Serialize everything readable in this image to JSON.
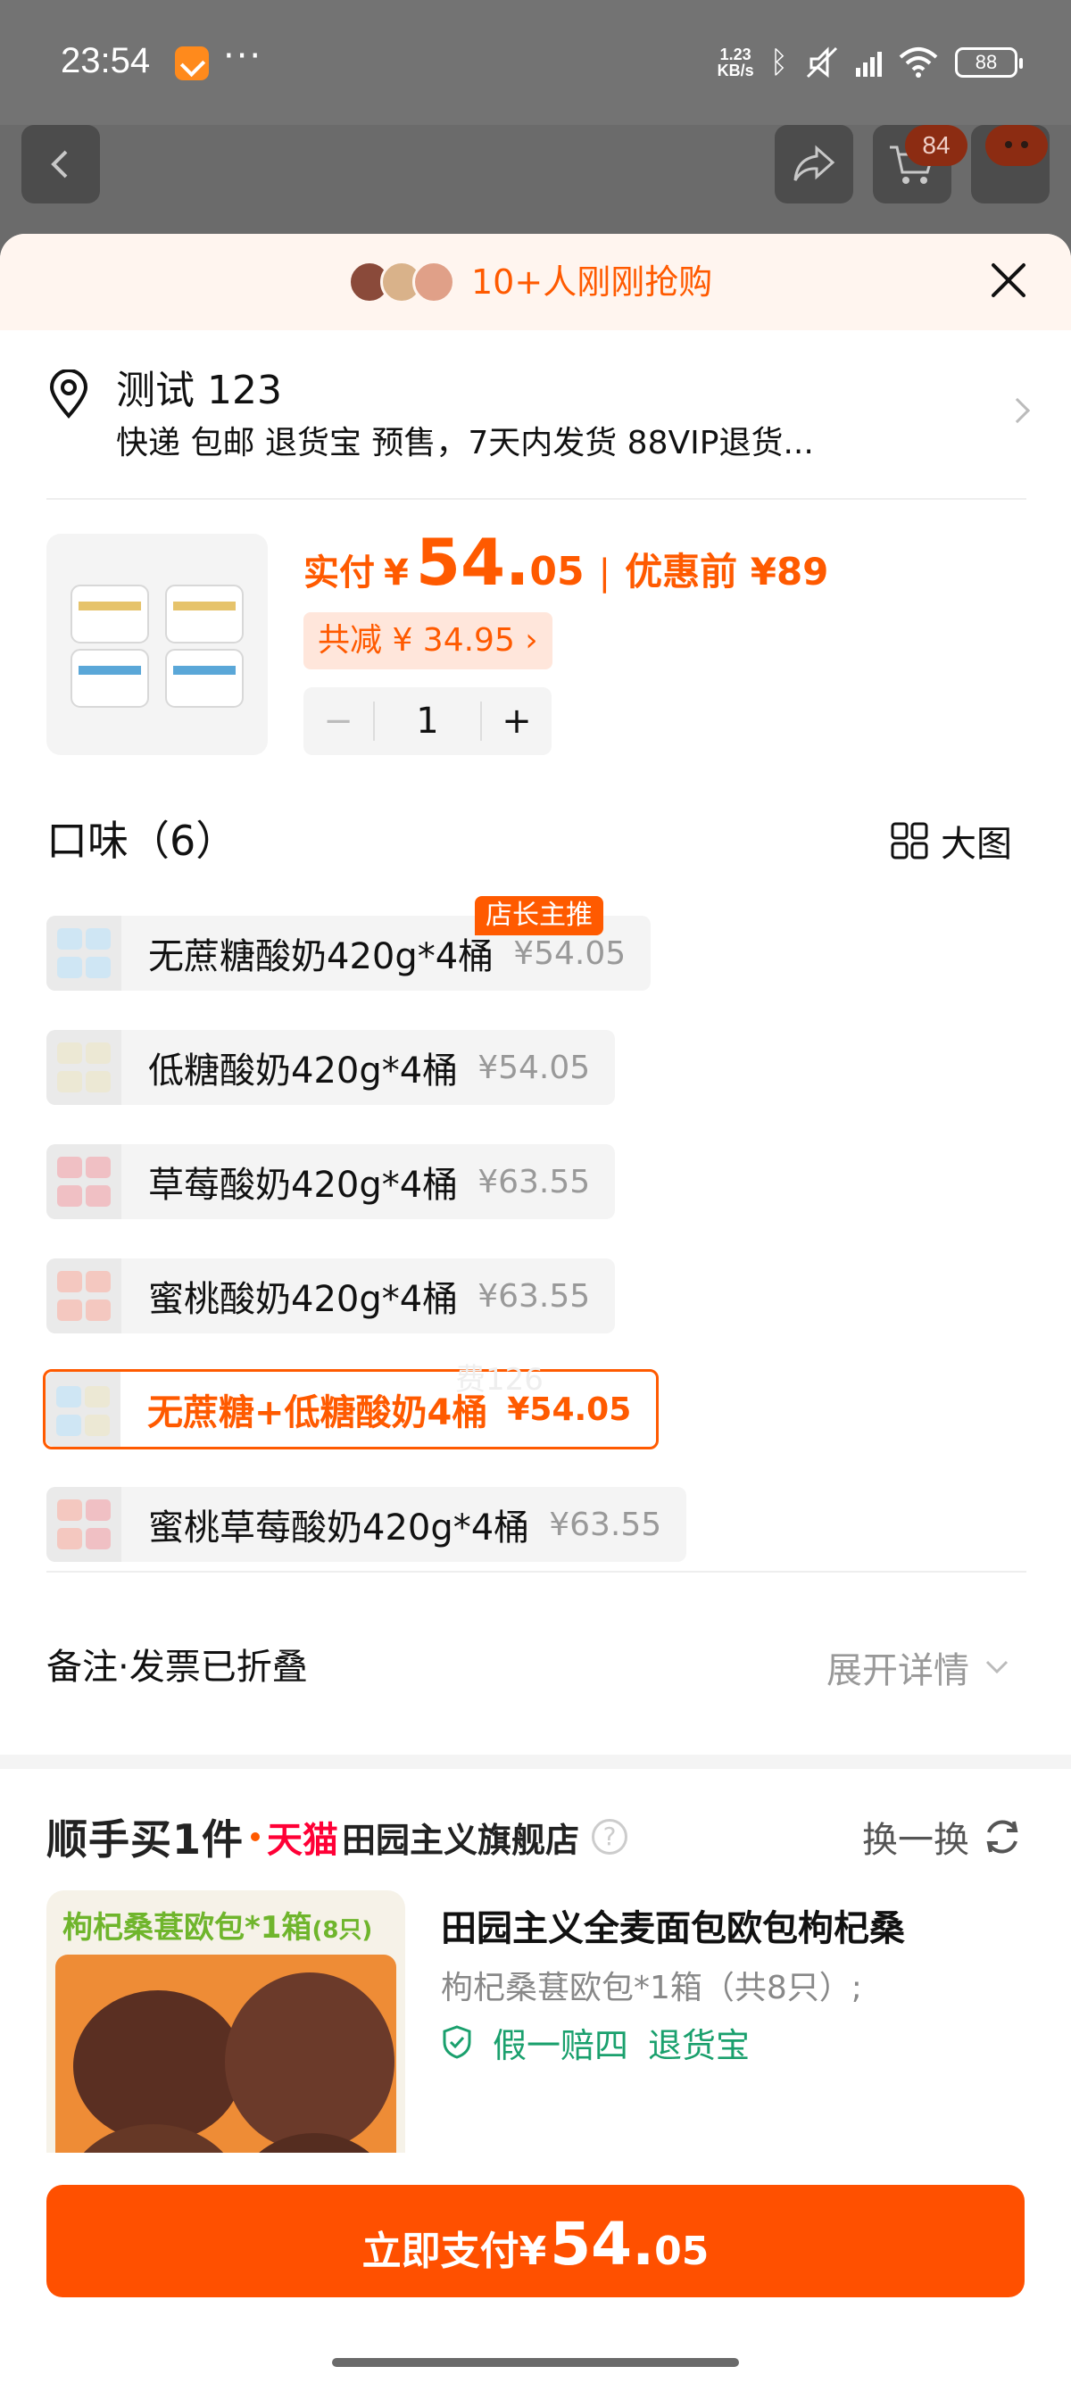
{
  "status_bar": {
    "time": "23:54",
    "speed_top": "1.23",
    "speed_bottom": "KB/s",
    "battery": "88",
    "dots": "···"
  },
  "nav": {
    "cart_badge": "84"
  },
  "banner": {
    "text": "10+人刚刚抢购"
  },
  "address": {
    "name": "测试 123",
    "info": "快递 包邮 退货宝 预售，7天内发货 88VIP退货..."
  },
  "product": {
    "pay_label": "实付",
    "currency": "¥",
    "price_int": "54.",
    "price_dec": "05",
    "separator": "|",
    "orig_price": "优惠前 ¥89",
    "saving": "共减 ¥ 34.95 ›",
    "qty_minus": "−",
    "qty": "1",
    "qty_plus": "+"
  },
  "flavor": {
    "title": "口味（6）",
    "bigview_label": "大图",
    "badge": "店长主推",
    "options": [
      {
        "name": "无蔗糖酸奶420g*4桶",
        "price": "¥54.05"
      },
      {
        "name": "低糖酸奶420g*4桶",
        "price": "¥54.05"
      },
      {
        "name": "草莓酸奶420g*4桶",
        "price": "¥63.55"
      },
      {
        "name": "蜜桃酸奶420g*4桶",
        "price": "¥63.55"
      },
      {
        "name": "无蔗糖+低糖酸奶4桶",
        "price": "¥54.05"
      },
      {
        "name": "蜜桃草莓酸奶420g*4桶",
        "price": "¥63.55"
      }
    ],
    "selected_index": 4
  },
  "remark": {
    "label": "备注·发票已折叠",
    "expand": "展开详情"
  },
  "watermark": "费126",
  "upsell": {
    "title": "顺手买1件",
    "tmall": "天猫",
    "shop": "田园主义旗舰店",
    "help": "?",
    "swap": "换一换",
    "card_title": "枸杞桑葚欧包*1箱",
    "card_title_small": "(8只)",
    "name": "田园主义全麦面包欧包枸杞桑",
    "spec": "枸杞桑葚欧包*1箱（共8只）;",
    "guarantee_1": "假一赔四",
    "guarantee_2": "退货宝"
  },
  "pay": {
    "label": "立即支付",
    "currency": "¥",
    "price_int": "54.",
    "price_dec": "05"
  },
  "colors": {
    "accent": "#ff5a00",
    "pay_button": "#ff5000",
    "green": "#1aa06d",
    "tmall": "#ff0036"
  }
}
